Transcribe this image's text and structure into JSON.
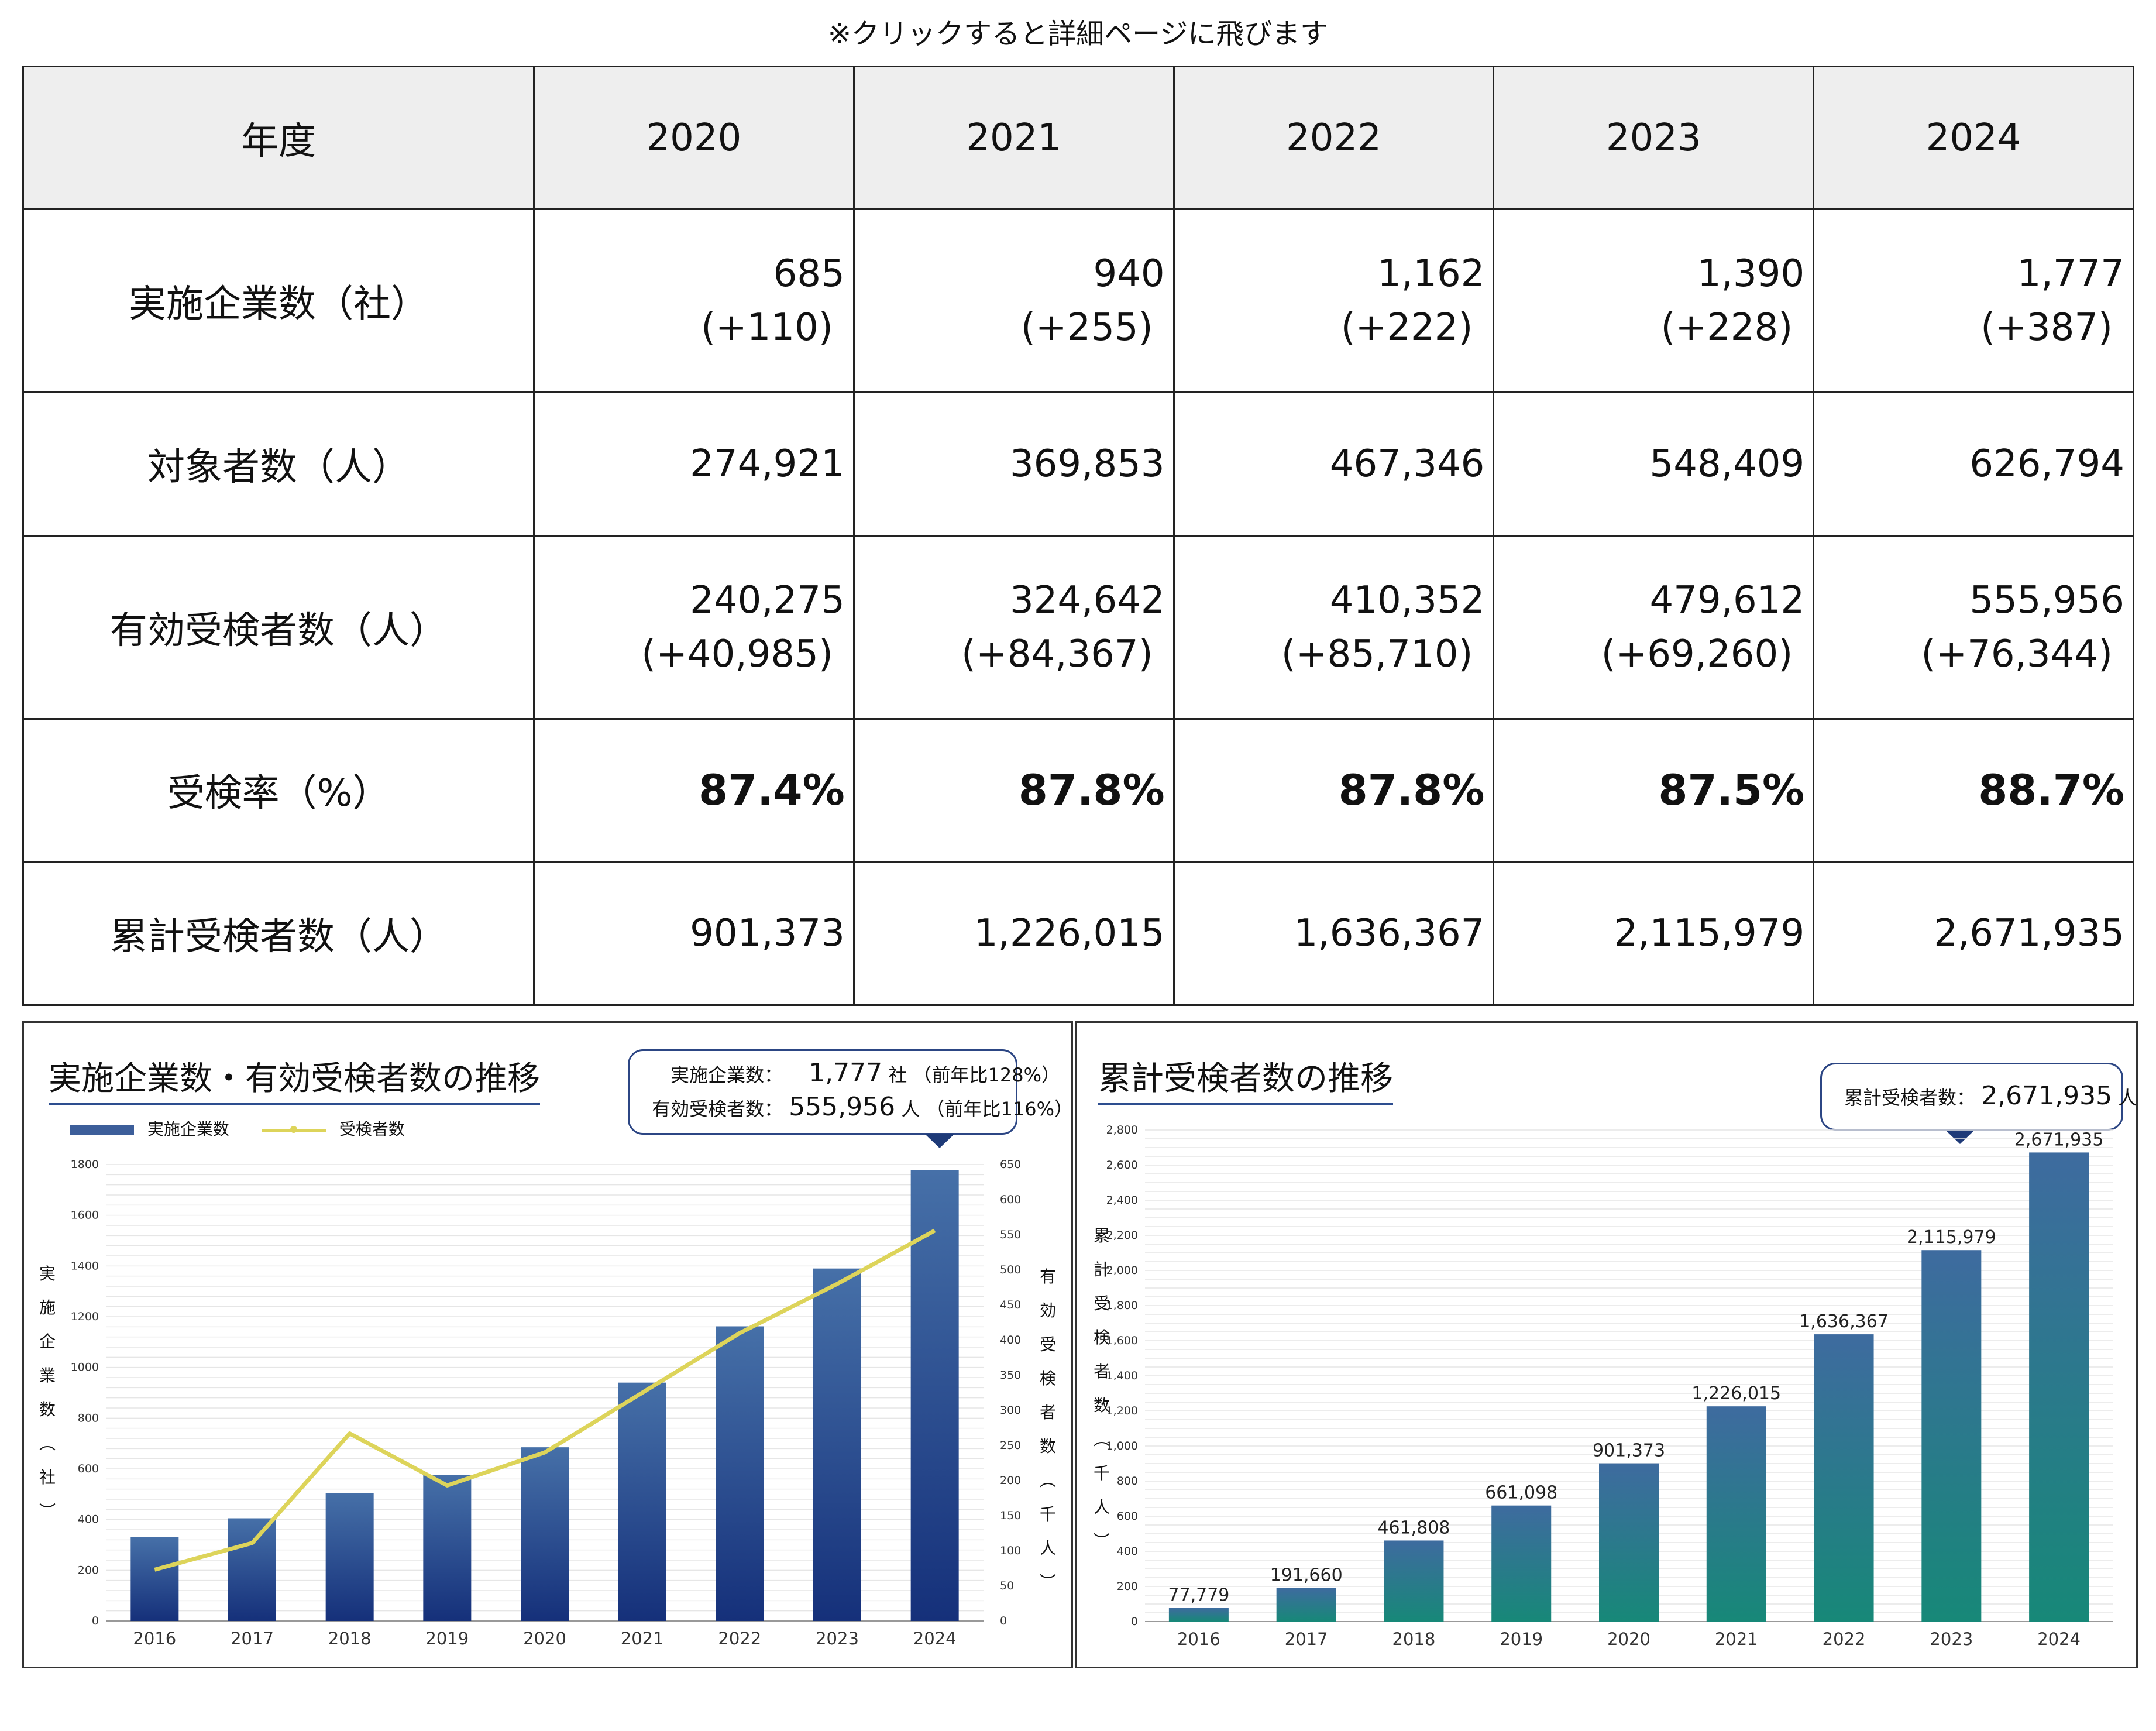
{
  "note": "※クリックすると詳細ページに飛びます",
  "table": {
    "header": [
      "年度",
      "2020",
      "2021",
      "2022",
      "2023",
      "2024"
    ],
    "rows": [
      {
        "label": "実施企業数（社）",
        "cells": [
          [
            "685",
            "(+110)"
          ],
          [
            "940",
            "(+255)"
          ],
          [
            "1,162",
            "(+222)"
          ],
          [
            "1,390",
            "(+228)"
          ],
          [
            "1,777",
            "(+387)"
          ]
        ]
      },
      {
        "label": "対象者数（人）",
        "cells": [
          [
            "274,921"
          ],
          [
            "369,853"
          ],
          [
            "467,346"
          ],
          [
            "548,409"
          ],
          [
            "626,794"
          ]
        ]
      },
      {
        "label": "有効受検者数（人）",
        "cells": [
          [
            "240,275",
            "(+40,985)"
          ],
          [
            "324,642",
            "(+84,367)"
          ],
          [
            "410,352",
            "(+85,710)"
          ],
          [
            "479,612",
            "(+69,260)"
          ],
          [
            "555,956",
            "(+76,344)"
          ]
        ]
      },
      {
        "label": "受検率（%）",
        "bold": true,
        "cells": [
          [
            "87.4%"
          ],
          [
            "87.8%"
          ],
          [
            "87.8%"
          ],
          [
            "87.5%"
          ],
          [
            "88.7%"
          ]
        ]
      },
      {
        "label": "累計受検者数（人）",
        "cells": [
          [
            "901,373"
          ],
          [
            "1,226,015"
          ],
          [
            "1,636,367"
          ],
          [
            "2,115,979"
          ],
          [
            "2,671,935"
          ]
        ]
      }
    ]
  },
  "left_panel": {
    "title": "実施企業数・有効受検者数の推移",
    "callout": {
      "line1_label": "実施企業数：",
      "line1_value": "1,777",
      "line1_unit": "社",
      "line1_note": "（前年比128%）",
      "line2_label": "有効受検者数：",
      "line2_value": "555,956",
      "line2_unit": "人",
      "line2_note": "（前年比116%）"
    },
    "legend_bar": "実施企業数",
    "legend_line": "受検者数",
    "ylabel_left": "実施企業数（社）",
    "ylabel_right": "有効受検者数（千人）"
  },
  "right_panel": {
    "title": "累計受検者数の推移",
    "callout": {
      "label": "累計受検者数：",
      "value": "2,671,935",
      "unit": "人"
    },
    "ylabel": "累計受検者数（千人）"
  },
  "chart_data": [
    {
      "type": "bar",
      "categories": [
        "2016",
        "2017",
        "2018",
        "2019",
        "2020",
        "2021",
        "2022",
        "2023",
        "2024"
      ],
      "series": [
        {
          "name": "実施企業数",
          "type": "bar",
          "axis": "left",
          "values": [
            330,
            405,
            505,
            575,
            685,
            940,
            1162,
            1390,
            1777
          ]
        },
        {
          "name": "受検者数",
          "type": "line",
          "axis": "right",
          "values": [
            73,
            111,
            267,
            193,
            240,
            325,
            410,
            480,
            556
          ]
        }
      ],
      "ylim_left": [
        0,
        1800
      ],
      "yticks_left": [
        "0",
        "200",
        "400",
        "600",
        "800",
        "1000",
        "1200",
        "1400",
        "1600",
        "1800"
      ],
      "ylim_right": [
        0,
        650
      ],
      "yticks_right": [
        "0",
        "50",
        "100",
        "150",
        "200",
        "250",
        "300",
        "350",
        "400",
        "450",
        "500",
        "550",
        "600",
        "650"
      ],
      "grid": true,
      "legend": "top-left",
      "colors": {
        "bar_top": "#4670a8",
        "bar_bottom": "#15307a",
        "line": "#ddd45a"
      }
    },
    {
      "type": "bar",
      "categories": [
        "2016",
        "2017",
        "2018",
        "2019",
        "2020",
        "2021",
        "2022",
        "2023",
        "2024"
      ],
      "values": [
        77.779,
        191.66,
        461.808,
        661.098,
        901.373,
        1226.015,
        1636.367,
        2115.979,
        2671.935
      ],
      "data_labels": [
        "77,779",
        "191,660",
        "461,808",
        "661,098",
        "901,373",
        "1,226,015",
        "1,636,367",
        "2,115,979",
        "2,671,935"
      ],
      "ylim": [
        0,
        2800
      ],
      "yticks": [
        "0",
        "200",
        "400",
        "600",
        "800",
        "1,000",
        "1,200",
        "1,400",
        "1,600",
        "1,800",
        "2,000",
        "2,200",
        "2,400",
        "2,600",
        "2,800"
      ],
      "grid": true,
      "colors": {
        "bar_top": "#3e6b9f",
        "bar_bottom": "#178878"
      }
    }
  ]
}
